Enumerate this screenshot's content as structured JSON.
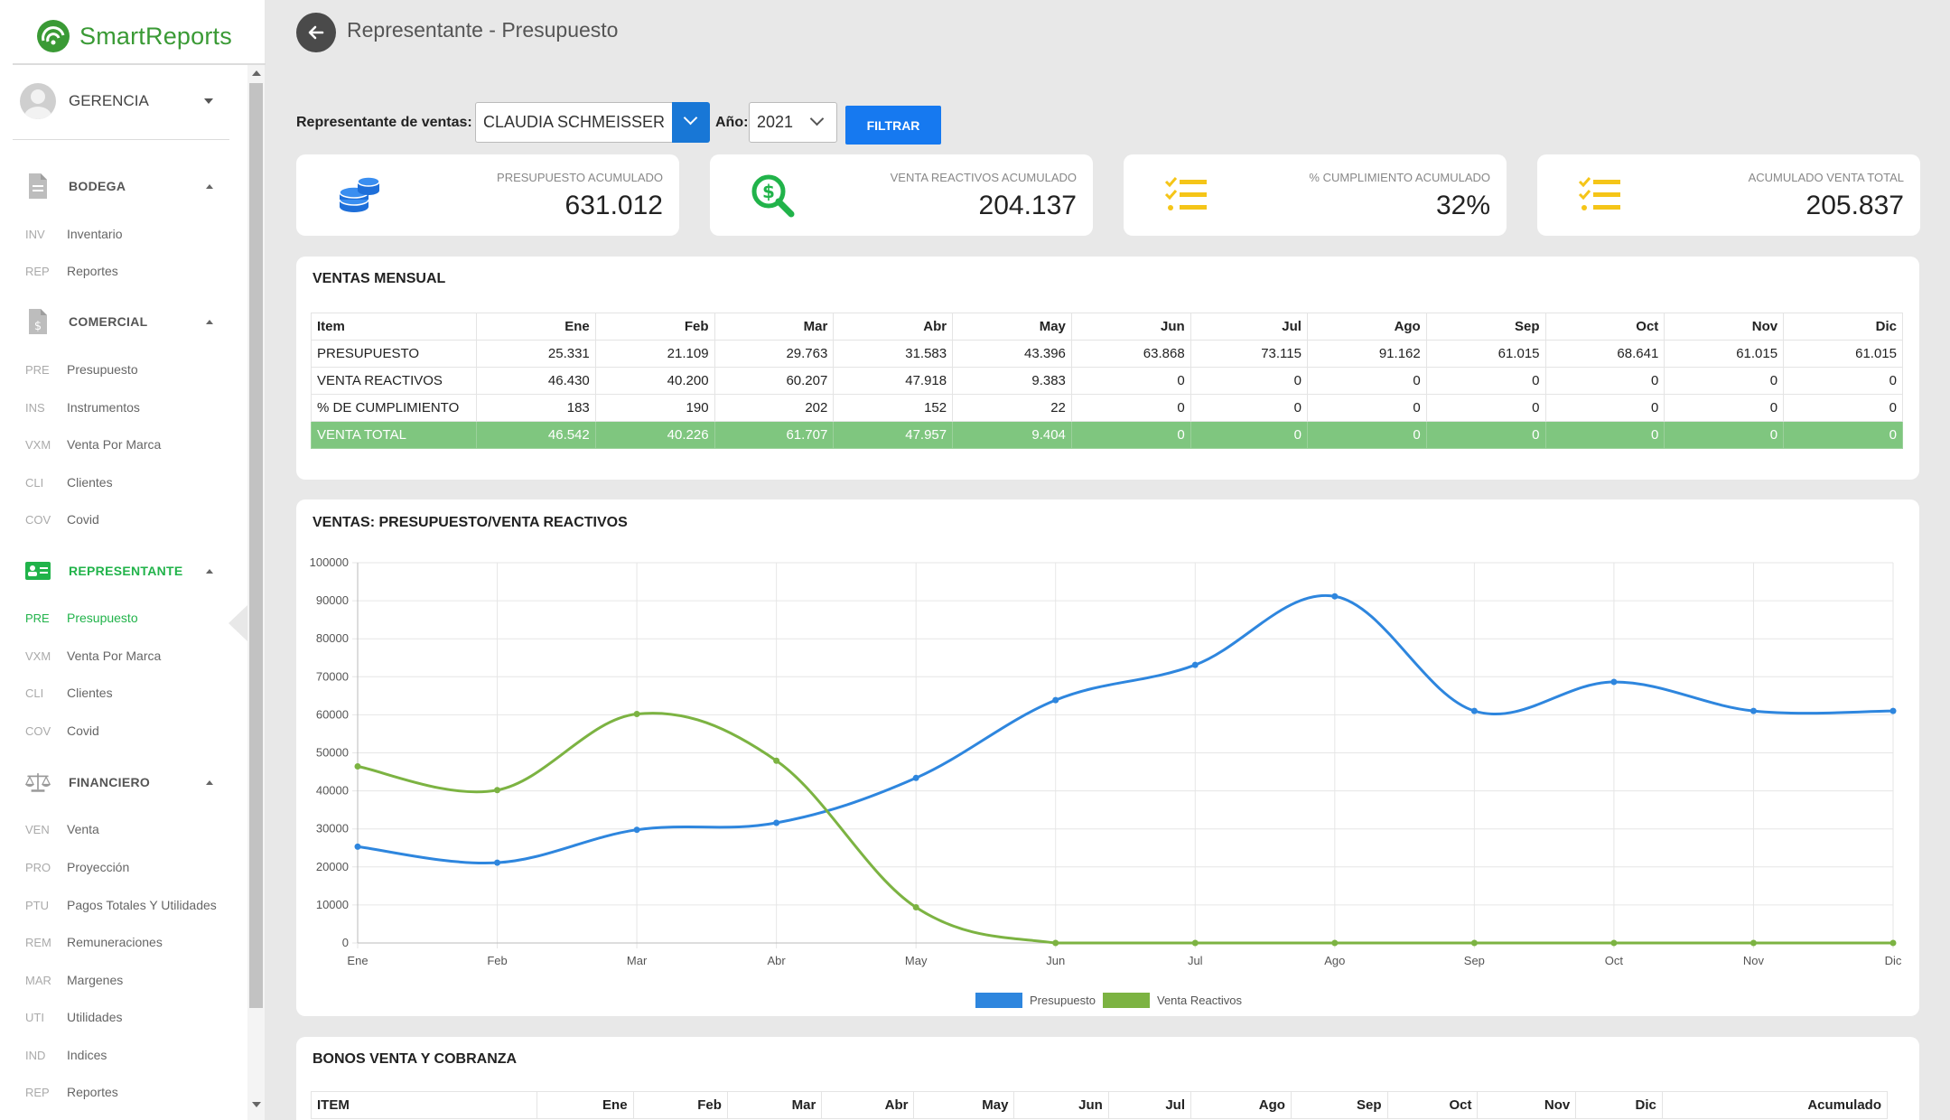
{
  "app": {
    "brand": "SmartReports",
    "accent": "#21b34a",
    "brand_color": "#3a9a35"
  },
  "user": {
    "name": "GERENCIA"
  },
  "sidebar": {
    "sections": [
      {
        "label": "BODEGA",
        "icon": "document-icon",
        "items": [
          {
            "abbr": "INV",
            "label": "Inventario"
          },
          {
            "abbr": "REP",
            "label": "Reportes"
          }
        ]
      },
      {
        "label": "COMERCIAL",
        "icon": "dollar-document-icon",
        "items": [
          {
            "abbr": "PRE",
            "label": "Presupuesto"
          },
          {
            "abbr": "INS",
            "label": "Instrumentos"
          },
          {
            "abbr": "VXM",
            "label": "Venta Por Marca"
          },
          {
            "abbr": "CLI",
            "label": "Clientes"
          },
          {
            "abbr": "COV",
            "label": "Covid"
          }
        ]
      },
      {
        "label": "REPRESENTANTE",
        "icon": "id-card-icon",
        "items": [
          {
            "abbr": "PRE",
            "label": "Presupuesto"
          },
          {
            "abbr": "VXM",
            "label": "Venta Por Marca"
          },
          {
            "abbr": "CLI",
            "label": "Clientes"
          },
          {
            "abbr": "COV",
            "label": "Covid"
          }
        ]
      },
      {
        "label": "FINANCIERO",
        "icon": "scale-icon",
        "items": [
          {
            "abbr": "VEN",
            "label": "Venta"
          },
          {
            "abbr": "PRO",
            "label": "Proyección"
          },
          {
            "abbr": "PTU",
            "label": "Pagos Totales Y Utilidades"
          },
          {
            "abbr": "REM",
            "label": "Remuneraciones"
          },
          {
            "abbr": "MAR",
            "label": "Margenes"
          },
          {
            "abbr": "UTI",
            "label": "Utilidades"
          },
          {
            "abbr": "IND",
            "label": "Indices"
          },
          {
            "abbr": "REP",
            "label": "Reportes"
          }
        ]
      }
    ]
  },
  "header": {
    "title": "Representante - Presupuesto"
  },
  "filters": {
    "rep_label": "Representante de ventas:",
    "rep_value": "CLAUDIA SCHMEISSER",
    "year_label": "Año:",
    "year_value": "2021",
    "button": "FILTRAR"
  },
  "kpis": [
    {
      "label": "PRESUPUESTO ACUMULADO",
      "value": "631.012",
      "icon": "coins-stack-icon",
      "color": "#1e6fd9"
    },
    {
      "label": "VENTA REACTIVOS ACUMULADO",
      "value": "204.137",
      "icon": "money-search-icon",
      "color": "#21b34a"
    },
    {
      "label": "% CUMPLIMIENTO ACUMULADO",
      "value": "32%",
      "icon": "checklist-icon",
      "color": "#f5c518"
    },
    {
      "label": "ACUMULADO VENTA TOTAL",
      "value": "205.837",
      "icon": "checklist-icon",
      "color": "#f5c518"
    }
  ],
  "ventas_mensual": {
    "title": "VENTAS MENSUAL",
    "headers": [
      "Item",
      "Ene",
      "Feb",
      "Mar",
      "Abr",
      "May",
      "Jun",
      "Jul",
      "Ago",
      "Sep",
      "Oct",
      "Nov",
      "Dic"
    ],
    "rows": [
      [
        "PRESUPUESTO",
        "25.331",
        "21.109",
        "29.763",
        "31.583",
        "43.396",
        "63.868",
        "73.115",
        "91.162",
        "61.015",
        "68.641",
        "61.015",
        "61.015"
      ],
      [
        "VENTA REACTIVOS",
        "46.430",
        "40.200",
        "60.207",
        "47.918",
        "9.383",
        "0",
        "0",
        "0",
        "0",
        "0",
        "0",
        "0"
      ],
      [
        "% DE CUMPLIMIENTO",
        "183",
        "190",
        "202",
        "152",
        "22",
        "0",
        "0",
        "0",
        "0",
        "0",
        "0",
        "0"
      ],
      [
        "VENTA TOTAL",
        "46.542",
        "40.226",
        "61.707",
        "47.957",
        "9.404",
        "0",
        "0",
        "0",
        "0",
        "0",
        "0",
        "0"
      ]
    ],
    "total_row_color": "#7fc67f"
  },
  "chart_title": "VENTAS: PRESUPUESTO/VENTA REACTIVOS",
  "chart_data": {
    "type": "line",
    "categories": [
      "Ene",
      "Feb",
      "Mar",
      "Abr",
      "May",
      "Jun",
      "Jul",
      "Ago",
      "Sep",
      "Oct",
      "Nov",
      "Dic"
    ],
    "series": [
      {
        "name": "Presupuesto",
        "color": "#2e86de",
        "values": [
          25331,
          21109,
          29763,
          31583,
          43396,
          63868,
          73115,
          91162,
          61015,
          68641,
          61015,
          61015
        ]
      },
      {
        "name": "Venta Reactivos",
        "color": "#7cb342",
        "values": [
          46430,
          40200,
          60207,
          47918,
          9383,
          0,
          0,
          0,
          0,
          0,
          0,
          0
        ]
      }
    ],
    "yticks": [
      "0",
      "10000",
      "20000",
      "30000",
      "40000",
      "50000",
      "60000",
      "70000",
      "80000",
      "90000",
      "100000"
    ],
    "ylim": [
      0,
      100000
    ],
    "grid": true,
    "legend": "bottom-center"
  },
  "bonos": {
    "title": "BONOS VENTA Y COBRANZA",
    "headers": [
      "ITEM",
      "Ene",
      "Feb",
      "Mar",
      "Abr",
      "May",
      "Jun",
      "Jul",
      "Ago",
      "Sep",
      "Oct",
      "Nov",
      "Dic",
      "Acumulado"
    ]
  }
}
